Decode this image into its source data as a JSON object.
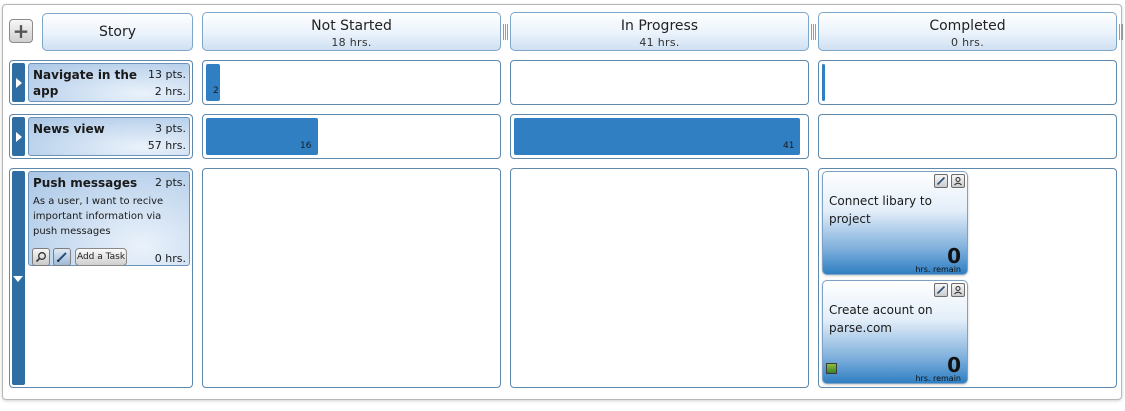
{
  "header": {
    "add_button_label": "+",
    "story_label": "Story",
    "columns": [
      {
        "title": "Not Started",
        "hours": "18 hrs."
      },
      {
        "title": "In Progress",
        "hours": "41 hrs."
      },
      {
        "title": "Completed",
        "hours": "0 hrs."
      }
    ]
  },
  "stories": [
    {
      "title": "Navigate in the app",
      "points": "13 pts.",
      "hours": "2 hrs.",
      "bars": {
        "not_started": {
          "value": 2,
          "label": "2"
        },
        "in_progress": null,
        "completed": {
          "value": 0
        }
      }
    },
    {
      "title": "News view",
      "points": "3 pts.",
      "hours": "57 hrs.",
      "bars": {
        "not_started": {
          "value": 16,
          "label": "16"
        },
        "in_progress": {
          "value": 41,
          "label": "41"
        },
        "completed": null
      }
    },
    {
      "title": "Push messages",
      "points": "2 pts.",
      "description": "As a user, I want to recive important information via push messages",
      "hours": "0 hrs.",
      "add_task_label": "Add a Task",
      "tasks_completed": [
        {
          "title": "Connect libary to project",
          "remaining": "0",
          "remaining_unit": "hrs. remain"
        },
        {
          "title": "Create acount on parse.com",
          "remaining": "0",
          "remaining_unit": "hrs. remain"
        }
      ]
    }
  ],
  "colors": {
    "bar": "#2f7fc2",
    "row_tab": "#2e6ea3",
    "cell_border": "#5f88ad"
  },
  "icons": [
    "plus-icon",
    "expand-arrow-icon",
    "collapse-arrow-icon",
    "search-icon",
    "pencil-icon",
    "user-icon"
  ]
}
